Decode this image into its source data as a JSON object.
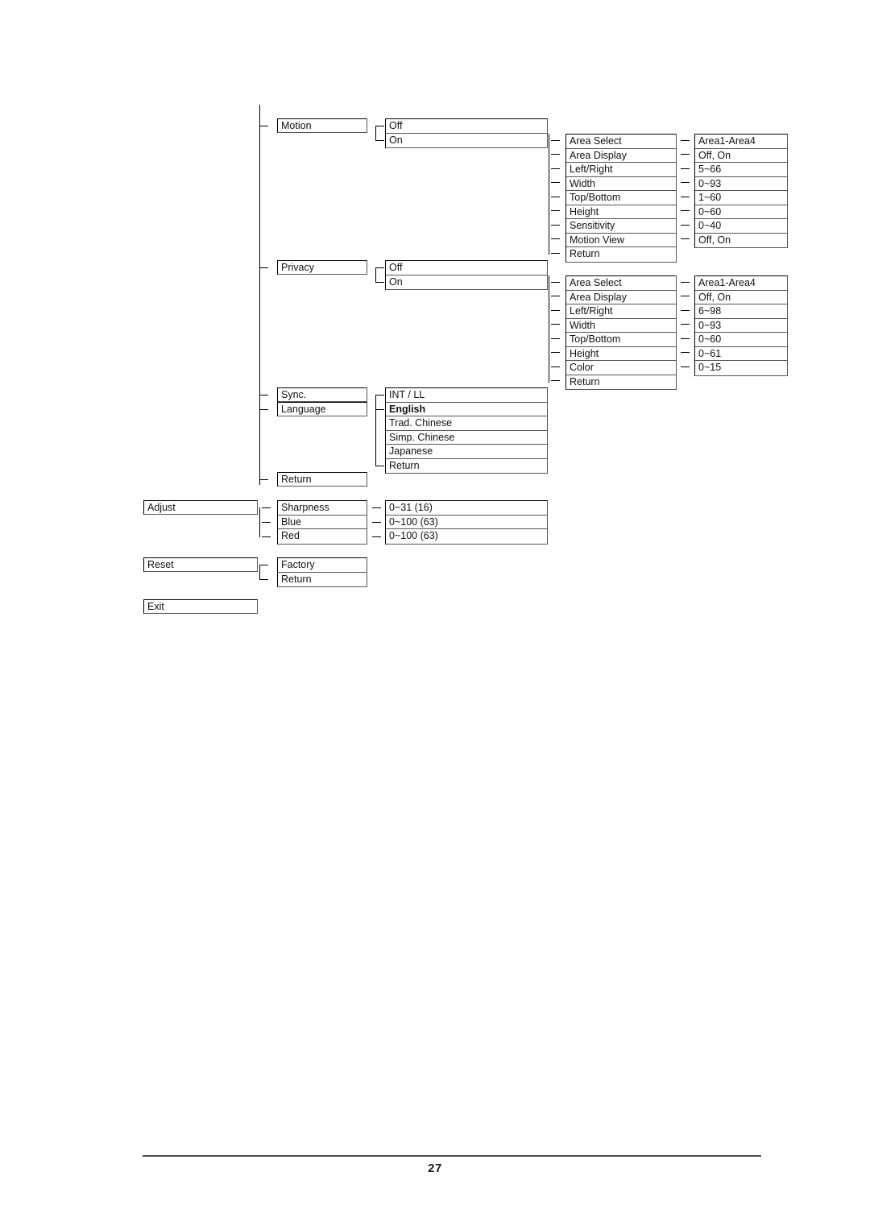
{
  "document": {
    "page_number": "27",
    "type": "osd-menu-tree-diagram"
  },
  "tree": {
    "level1": {
      "motion": "Motion",
      "privacy": "Privacy",
      "sync": "Sync.",
      "language": "Language",
      "return": "Return",
      "adjust": "Adjust",
      "reset": "Reset",
      "exit": "Exit"
    },
    "motion_states": [
      "Off",
      "On"
    ],
    "motion_submenu": [
      "Area Select",
      "Area Display",
      "Left/Right",
      "Width",
      "Top/Bottom",
      "Height",
      "Sensitivity",
      "Motion View",
      "Return"
    ],
    "motion_values": [
      "Area1-Area4",
      "Off, On",
      "5~66",
      "0~93",
      "1~60",
      "0~60",
      "0~40",
      "Off, On"
    ],
    "privacy_states": [
      "Off",
      "On"
    ],
    "privacy_submenu": [
      "Area Select",
      "Area Display",
      "Left/Right",
      "Width",
      "Top/Bottom",
      "Height",
      "Color",
      "Return"
    ],
    "privacy_values": [
      "Area1-Area4",
      "Off, On",
      "6~98",
      "0~93",
      "0~60",
      "0~61",
      "0~15"
    ],
    "sync_language_options": [
      "INT /  LL",
      "English",
      "Trad. Chinese",
      "Simp. Chinese",
      "Japanese",
      "Return"
    ],
    "adjust_submenu": [
      "Sharpness",
      "Blue",
      "Red"
    ],
    "adjust_values": [
      "0~31  (16)",
      "0~100  (63)",
      "0~100 (63)"
    ],
    "reset_submenu": [
      "Factory",
      "Return"
    ]
  },
  "colors": {
    "line": "#000000",
    "box_border": "#000000",
    "box_shadow_border": "#555555",
    "footer_rule": "#4d4d4d",
    "text": "#111111"
  }
}
